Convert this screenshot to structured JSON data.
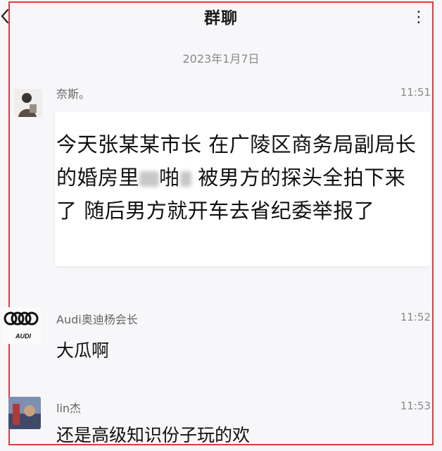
{
  "header": {
    "title": "群聊",
    "more_label": "⋮"
  },
  "date_separator": "2023年1月7日",
  "messages": [
    {
      "sender": "奈斯。",
      "time": "11:51",
      "text_parts": [
        "今天张某某市长 在广陵区商务局副局长 的婚房里",
        "",
        "啪",
        "",
        " 被男方的探头全拍下来了 随后男方就开车去省纪委举报了"
      ]
    },
    {
      "sender": "Audi奥迪杨会长",
      "time": "11:52",
      "text": "大瓜啊",
      "avatar_text": "AUDI"
    },
    {
      "sender": "lin杰",
      "time": "11:53",
      "text": "还是高级知识份子玩的欢"
    }
  ],
  "colors": {
    "frame": "#e23a3a",
    "background": "#f7f7f9",
    "bubble": "#ffffff"
  }
}
